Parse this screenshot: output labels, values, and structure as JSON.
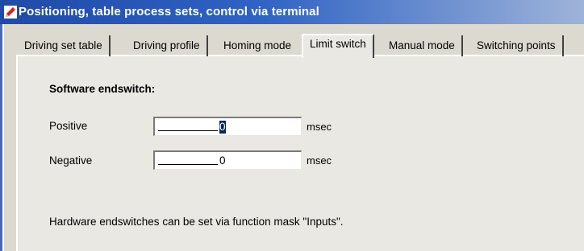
{
  "window": {
    "title": "Positioning, table process sets, control via terminal",
    "title_color": "#ffffff",
    "accent": "#1f4aa8"
  },
  "tabs": [
    {
      "label": "Driving set table",
      "active": false
    },
    {
      "label": "Driving profile",
      "active": false
    },
    {
      "label": "Homing mode",
      "active": false
    },
    {
      "label": "Limit switch",
      "active": true
    },
    {
      "label": "Manual mode",
      "active": false
    },
    {
      "label": "Switching points",
      "active": false
    }
  ],
  "limit_switch": {
    "section_title": "Software endswitch:",
    "positive": {
      "label": "Positive",
      "value": "0",
      "unit": "msec"
    },
    "negative": {
      "label": "Negative",
      "value": "0",
      "unit": "msec"
    },
    "hint": "Hardware endswitches can be set via function mask \"Inputs\"."
  },
  "icons": {
    "app": "edit-pencil-icon"
  }
}
